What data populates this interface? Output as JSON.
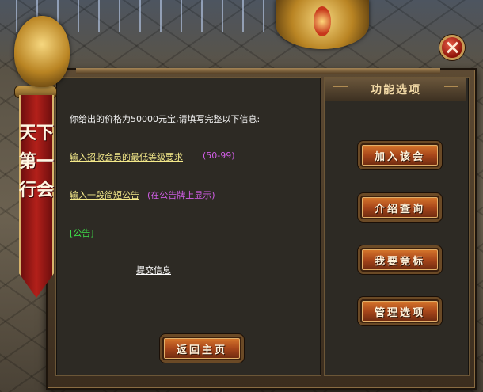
{
  "banner": {
    "text": "天下第一行会"
  },
  "main": {
    "intro_prefix": "你给出的价格为",
    "price": "50000",
    "intro_suffix": "元宝,请填写完整以下信息:",
    "min_level_link": "输入招收会员的最低等级要求",
    "min_level_range": "(50-99)",
    "announcement_link": "输入一段简短公告",
    "announcement_note": "(在公告牌上显示)",
    "announcement_tag": "[公告]",
    "submit_link": "提交信息",
    "return_button": "返回主页"
  },
  "side_panel": {
    "title": "功能选项",
    "buttons": [
      "加入该会",
      "介绍查询",
      "我要竞标",
      "管理选项"
    ]
  },
  "colors": {
    "link_yellow": "#f4e98a",
    "note_purple": "#d25ee8",
    "note_green": "#3fe04a",
    "button_orange": "#c2602a"
  }
}
